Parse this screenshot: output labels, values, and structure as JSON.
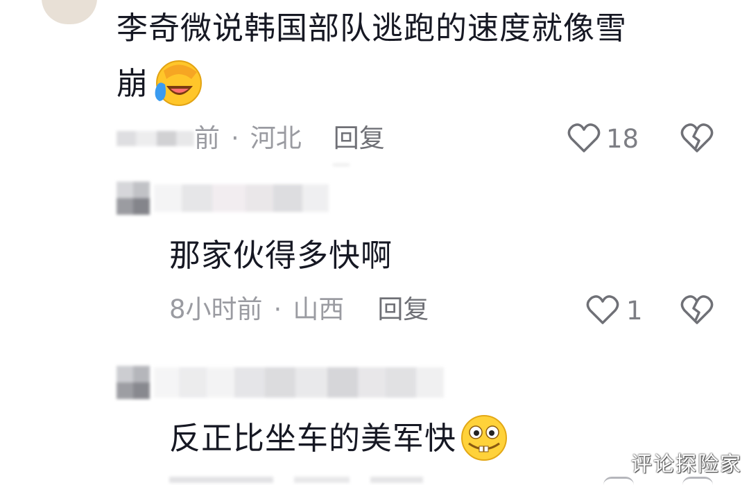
{
  "comments": [
    {
      "text_line1": "李奇微说韩国部队逃跑的速度就像雪",
      "text_line2": "崩",
      "emoji": "facepalm-crying-laugh-emoji",
      "time": "前",
      "dot": "·",
      "location": "河北",
      "reply_label": "回复",
      "likes": "18"
    },
    {
      "text": "那家伙得多快啊",
      "time": "8小时前",
      "dot": "·",
      "location": "山西",
      "reply_label": "回复",
      "likes": "1"
    },
    {
      "text": "反正比坐车的美军快",
      "emoji": "grinning-bucktooth-emoji"
    }
  ],
  "icons": {
    "like": "heart-outline-icon",
    "dislike": "broken-heart-icon"
  },
  "colors": {
    "text": "#161823",
    "meta": "#9a9ba1",
    "reply": "#6f7076",
    "emoji_yellow": "#ffc62a"
  },
  "watermark": "评论探险家"
}
